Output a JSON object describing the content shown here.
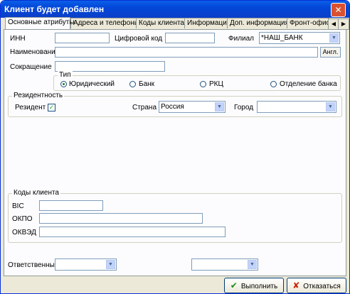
{
  "window": {
    "title": "Клиент будет добавлен",
    "close_symbol": "✕"
  },
  "tabs": [
    {
      "label": "Основные атрибуты",
      "active": true
    },
    {
      "label": "Адреса и телефоны"
    },
    {
      "label": "Коды клиента"
    },
    {
      "label": "Информация"
    },
    {
      "label": "Доп. информация"
    },
    {
      "label": "Фронт-офис"
    }
  ],
  "tab_nav": {
    "left_icon": "◀",
    "right_icon": "▶"
  },
  "fields": {
    "inn_label": "ИНН",
    "inn_value": "",
    "digital_code_label": "Цифровой код",
    "digital_code_value": "",
    "branch_label": "Филиал",
    "branch_value": "*НАШ_БАНК",
    "name_label": "Наименование",
    "name_value": "",
    "angl_button": "Англ.",
    "short_label": "Сокращение",
    "short_value": ""
  },
  "type_group": {
    "title": "Тип",
    "options": [
      "Юридический",
      "Банк",
      "РКЦ",
      "Отделение банка"
    ],
    "selected": "Юридический"
  },
  "residency": {
    "title": "Резидентность",
    "resident_label": "Резидент",
    "resident_checked": true,
    "check_mark": "✓",
    "country_label": "Страна",
    "country_value": "Россия",
    "city_label": "Город",
    "city_value": ""
  },
  "client_codes": {
    "title": "Коды клиента",
    "bic_label": "BIC",
    "bic_value": "",
    "okpo_label": "ОКПО",
    "okpo_value": "",
    "okved_label": "ОКВЭД",
    "okved_value": ""
  },
  "responsible": {
    "label": "Ответственные",
    "value1": "",
    "value2": ""
  },
  "buttons": {
    "ok_label": "Выполнить",
    "ok_icon": "✔",
    "cancel_label": "Отказаться",
    "cancel_icon": "✘"
  },
  "dropdown_icon": "▼",
  "colors": {
    "title_bar": "#0a5fe8",
    "close_button": "#d9512f",
    "ok_icon": "#1a8a1a",
    "cancel_icon": "#cc2200"
  }
}
